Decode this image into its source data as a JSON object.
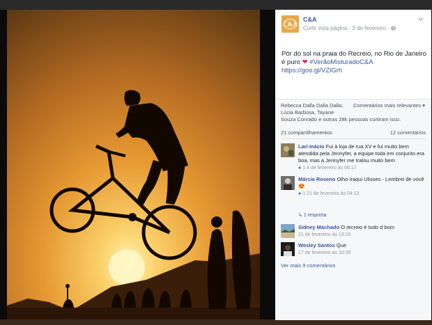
{
  "post": {
    "page_name": "C&A",
    "logo_text": "C&A",
    "meta_link": "Curtir esta página",
    "meta_separator": "·",
    "date": "3 de fevereiro",
    "globe_icon": "globe-icon",
    "text_main": "Pôr do sol na praia do Recreio, no Rio de Janeiro é puro ",
    "heart": "❤",
    "text_tail": " #VerãoMisturadoC&A https://goo.gl/VZlGrh"
  },
  "engagement": {
    "likes_names": "Rebecca Dalla Dalla Dalla, Lúcia Barbosa, Tayane",
    "likes_rest": "Souza Conrado e outras 28k pessoas curtiram isso.",
    "sort_label": "Comentários mais relevantes",
    "shares": "21 compartilhamentos",
    "comments_count": "12 comentários"
  },
  "comments": [
    {
      "name": "Lari Inácio",
      "text": " Fui à loja de rua XV e fui muito bem atendida pela Jennyfer, a equipe toda em conjunto era boa, mas a Jennyfer me tratou muito bem",
      "likes": "1",
      "timestamp": "4 de fevereiro às 06:17"
    },
    {
      "name": "Márcia Roseno",
      "text": " Olho Iraqui Ulisses - Lembrei de você ",
      "emoji": "😍",
      "likes": "1",
      "timestamp": "21 de fevereiro às 04:13",
      "reply_label": "1 resposta"
    },
    {
      "name": "Sidney Machado",
      "text": " O recreio é tudo d bom",
      "timestamp": "21 de fevereiro às 13:10"
    },
    {
      "name": "Wesley Santos",
      "text": " Que",
      "timestamp": "17 de fevereiro às 10:39"
    }
  ],
  "more_comments": "Ver mais 9 comentários",
  "colors": {
    "link": "#365899",
    "meta": "#90949c",
    "sunset": "#f2a33a",
    "panel_bg": "#f6f7f9"
  }
}
